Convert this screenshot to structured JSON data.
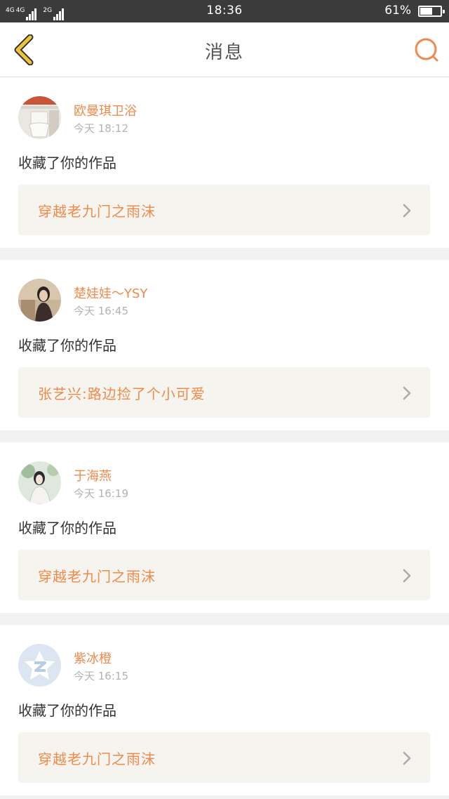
{
  "status_bar": {
    "network1": "4G",
    "network1b": "4G",
    "network2": "2G",
    "time": "18:36",
    "battery": "61%",
    "battery_level": 0.61
  },
  "header": {
    "title": "消息",
    "back_icon": "chevron-left-icon",
    "search_icon": "search-icon"
  },
  "colors": {
    "accent": "#f08a4b",
    "back_icon": "#f0c43a",
    "card_link_bg": "#f5f4ee"
  },
  "messages": [
    {
      "username": "欧曼琪卫浴",
      "time": "今天 18:12",
      "action": "收藏了你的作品",
      "work_title": "穿越老九门之雨沫"
    },
    {
      "username": "楚娃娃～YSY",
      "time": "今天 16:45",
      "action": "收藏了你的作品",
      "work_title": "张艺兴:路边捡了个小可爱"
    },
    {
      "username": "于海燕",
      "time": "今天 16:19",
      "action": "收藏了你的作品",
      "work_title": "穿越老九门之雨沫"
    },
    {
      "username": "紫冰橙",
      "time": "今天 16:15",
      "action": "收藏了你的作品",
      "work_title": "穿越老九门之雨沫"
    }
  ]
}
